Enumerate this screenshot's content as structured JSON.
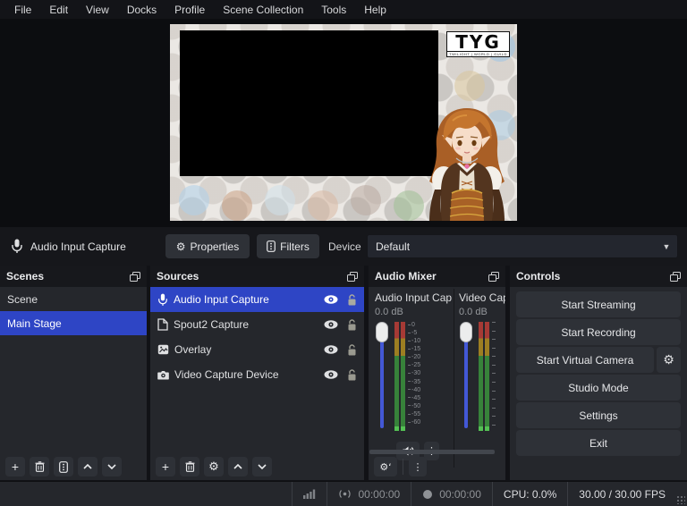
{
  "menu": {
    "items": [
      "File",
      "Edit",
      "View",
      "Docks",
      "Profile",
      "Scene Collection",
      "Tools",
      "Help"
    ]
  },
  "preview": {
    "logo_title": "TYG",
    "logo_subtitle": "TWILIGHT | WORLD | GUILD"
  },
  "toolbar": {
    "source_label": "Audio Input Capture",
    "properties_label": "Properties",
    "filters_label": "Filters",
    "device_label": "Device",
    "device_value": "Default"
  },
  "scenes": {
    "title": "Scenes",
    "items": [
      {
        "label": "Scene"
      },
      {
        "label": "Main Stage"
      }
    ]
  },
  "sources": {
    "title": "Sources",
    "items": [
      {
        "label": "Audio Input Capture",
        "icon": "microphone"
      },
      {
        "label": "Spout2 Capture",
        "icon": "file"
      },
      {
        "label": "Overlay",
        "icon": "image"
      },
      {
        "label": "Video Capture Device",
        "icon": "camera"
      }
    ]
  },
  "mixer": {
    "title": "Audio Mixer",
    "channels": [
      {
        "name": "Audio Input Cap",
        "volume_db": "0.0 dB"
      },
      {
        "name": "Video Capt",
        "volume_db": "0.0 dB"
      }
    ],
    "scale": [
      "0",
      "-5",
      "-10",
      "-15",
      "-20",
      "-25",
      "-30",
      "-35",
      "-40",
      "-45",
      "-50",
      "-55",
      "-60"
    ]
  },
  "controls": {
    "title": "Controls",
    "buttons": [
      "Start Streaming",
      "Start Recording",
      "Start Virtual Camera",
      "Studio Mode",
      "Settings",
      "Exit"
    ]
  },
  "status": {
    "stream_time": "00:00:00",
    "record_time": "00:00:00",
    "cpu": "CPU: 0.0%",
    "fps": "30.00 / 30.00 FPS"
  },
  "colors": {
    "accent_selection": "#2e45c5",
    "slider_blue": "#4358d6",
    "meter_red": "#a63a35",
    "meter_yellow": "#9d7e22",
    "meter_green": "#37823a",
    "panel_bg": "#25272c",
    "header_bg": "#17181c"
  }
}
